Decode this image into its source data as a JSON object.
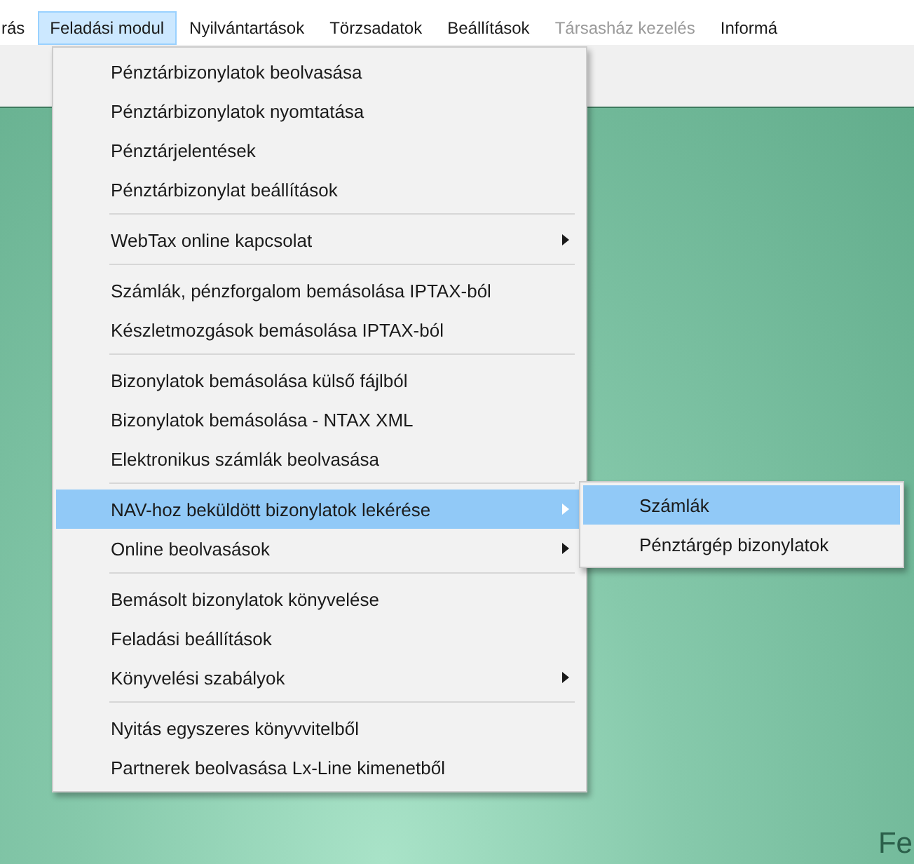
{
  "menubar": [
    {
      "label": "rás",
      "selected": false,
      "disabled": false
    },
    {
      "label": "Feladási modul",
      "selected": true,
      "disabled": false
    },
    {
      "label": "Nyilvántartások",
      "selected": false,
      "disabled": false
    },
    {
      "label": "Törzsadatok",
      "selected": false,
      "disabled": false
    },
    {
      "label": "Beállítások",
      "selected": false,
      "disabled": false
    },
    {
      "label": "Társasház kezelés",
      "selected": false,
      "disabled": true
    },
    {
      "label": "Informá",
      "selected": false,
      "disabled": false
    }
  ],
  "menu": {
    "sections": [
      [
        {
          "label": "Pénztárbizonylatok beolvasása",
          "selected": false,
          "submenu": false
        },
        {
          "label": "Pénztárbizonylatok nyomtatása",
          "selected": false,
          "submenu": false
        },
        {
          "label": "Pénztárjelentések",
          "selected": false,
          "submenu": false
        },
        {
          "label": "Pénztárbizonylat beállítások",
          "selected": false,
          "submenu": false
        }
      ],
      [
        {
          "label": "WebTax online kapcsolat",
          "selected": false,
          "submenu": true
        }
      ],
      [
        {
          "label": "Számlák, pénzforgalom bemásolása IPTAX-ból",
          "selected": false,
          "submenu": false
        },
        {
          "label": "Készletmozgások bemásolása IPTAX-ból",
          "selected": false,
          "submenu": false
        }
      ],
      [
        {
          "label": "Bizonylatok bemásolása külső fájlból",
          "selected": false,
          "submenu": false
        },
        {
          "label": "Bizonylatok bemásolása - NTAX XML",
          "selected": false,
          "submenu": false
        },
        {
          "label": "Elektronikus számlák beolvasása",
          "selected": false,
          "submenu": false
        }
      ],
      [
        {
          "label": "NAV-hoz beküldött bizonylatok lekérése",
          "selected": true,
          "submenu": true
        },
        {
          "label": "Online beolvasások",
          "selected": false,
          "submenu": true
        }
      ],
      [
        {
          "label": "Bemásolt bizonylatok könyvelése",
          "selected": false,
          "submenu": false
        },
        {
          "label": "Feladási beállítások",
          "selected": false,
          "submenu": false
        },
        {
          "label": "Könyvelési szabályok",
          "selected": false,
          "submenu": true
        }
      ],
      [
        {
          "label": "Nyitás egyszeres könyvvitelből",
          "selected": false,
          "submenu": false
        },
        {
          "label": "Partnerek beolvasása Lx-Line kimenetből",
          "selected": false,
          "submenu": false
        }
      ]
    ]
  },
  "submenu": {
    "items": [
      {
        "label": "Számlák",
        "selected": true
      },
      {
        "label": "Pénztárgép bizonylatok",
        "selected": false
      }
    ]
  },
  "background_text": "Fe"
}
